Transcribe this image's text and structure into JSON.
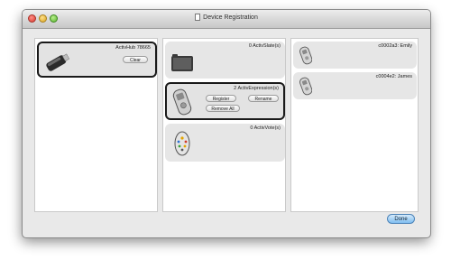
{
  "window": {
    "title": "Device Registration"
  },
  "hub": {
    "name": "ActivHub 78665",
    "clear_label": "Clear"
  },
  "device_types": {
    "slate": {
      "title": "0 ActivSlate(s)"
    },
    "expression": {
      "title": "2 ActivExpression(s)",
      "register_label": "Register",
      "rename_label": "Rename",
      "remove_all_label": "Remove All"
    },
    "vote": {
      "title": "0 ActivVote(s)"
    }
  },
  "registered": [
    {
      "label": "c0002a3: Emily"
    },
    {
      "label": "c0004e2: James"
    }
  ],
  "footer": {
    "done_label": "Done"
  },
  "icons": {
    "hub": "usb-dongle-icon",
    "slate": "slate-tablet-icon",
    "expression": "handset-icon",
    "vote": "voting-remote-icon",
    "device": "handset-small-icon"
  },
  "colors": {
    "done_button": "#7fbdf0",
    "selected_border": "#1a1a1a"
  }
}
